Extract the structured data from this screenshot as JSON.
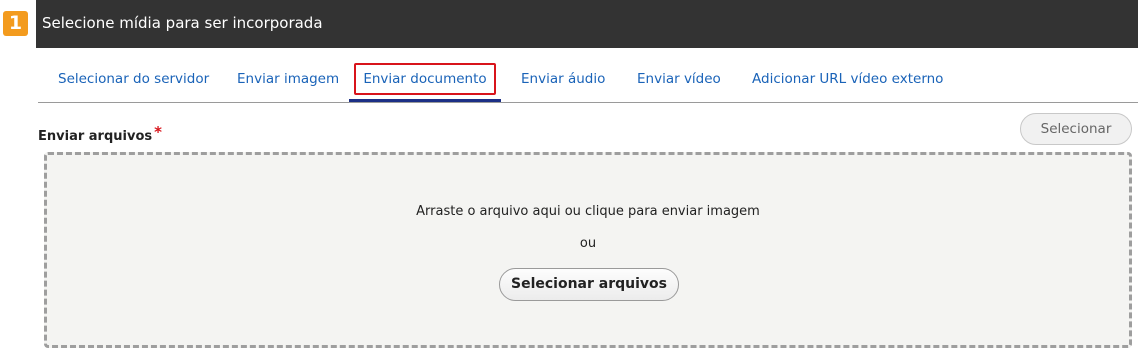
{
  "step": {
    "number": "1"
  },
  "header": {
    "title": "Selecione mídia para ser incorporada"
  },
  "tabs": [
    {
      "label": "Selecionar do servidor",
      "active": false
    },
    {
      "label": "Enviar imagem",
      "active": false
    },
    {
      "label": "Enviar documento",
      "active": true
    },
    {
      "label": "Enviar áudio",
      "active": false
    },
    {
      "label": "Enviar vídeo",
      "active": false
    },
    {
      "label": "Adicionar URL vídeo externo",
      "active": false
    }
  ],
  "upload": {
    "label": "Enviar arquivos",
    "required_marker": "*",
    "select_button": "Selecionar",
    "dropzone_text": "Arraste o arquivo aqui ou clique para enviar imagem",
    "or_text": "ou",
    "select_files_button": "Selecionar arquivos"
  },
  "colors": {
    "badge": "#f39b1e",
    "title_bar": "#333333",
    "tab_link": "#1a63b8",
    "active_underline": "#1c2f86",
    "highlight": "#d8141b"
  }
}
